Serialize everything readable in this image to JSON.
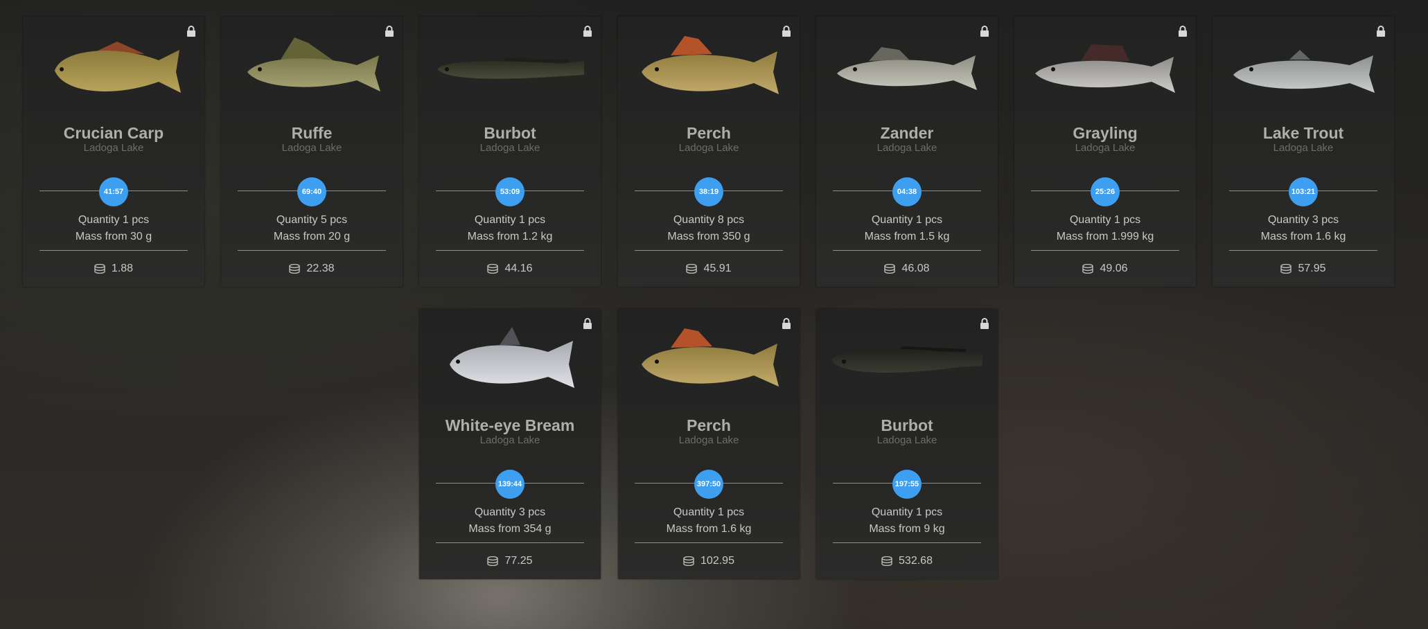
{
  "colors": {
    "timer": "#3e9ff0",
    "card": "#242424"
  },
  "cards": [
    {
      "name": "Crucian Carp",
      "location": "Ladoga Lake",
      "timer": "41:57",
      "quantity": "Quantity 1 pcs",
      "mass": "Mass from 30 g",
      "price": "1.88",
      "fish": "crucian",
      "icon": "lock-icon"
    },
    {
      "name": "Ruffe",
      "location": "Ladoga Lake",
      "timer": "69:40",
      "quantity": "Quantity 5 pcs",
      "mass": "Mass from 20 g",
      "price": "22.38",
      "fish": "ruffe",
      "icon": "lock-icon"
    },
    {
      "name": "Burbot",
      "location": "Ladoga Lake",
      "timer": "53:09",
      "quantity": "Quantity 1 pcs",
      "mass": "Mass from 1.2 kg",
      "price": "44.16",
      "fish": "burbot",
      "icon": "lock-icon"
    },
    {
      "name": "Perch",
      "location": "Ladoga Lake",
      "timer": "38:19",
      "quantity": "Quantity 8 pcs",
      "mass": "Mass from 350 g",
      "price": "45.91",
      "fish": "perch",
      "icon": "lock-icon"
    },
    {
      "name": "Zander",
      "location": "Ladoga Lake",
      "timer": "04:38",
      "quantity": "Quantity 1 pcs",
      "mass": "Mass from 1.5 kg",
      "price": "46.08",
      "fish": "zander",
      "icon": "lock-icon"
    },
    {
      "name": "Grayling",
      "location": "Ladoga Lake",
      "timer": "25:26",
      "quantity": "Quantity 1 pcs",
      "mass": "Mass from 1.999 kg",
      "price": "49.06",
      "fish": "grayling",
      "icon": "lock-icon"
    },
    {
      "name": "Lake Trout",
      "location": "Ladoga Lake",
      "timer": "103:21",
      "quantity": "Quantity 3 pcs",
      "mass": "Mass from 1.6 kg",
      "price": "57.95",
      "fish": "trout",
      "icon": "lock-icon"
    },
    {
      "name": "White-eye Bream",
      "location": "Ladoga Lake",
      "timer": "139:44",
      "quantity": "Quantity 3 pcs",
      "mass": "Mass from 354 g",
      "price": "77.25",
      "fish": "bream",
      "icon": "lock-icon"
    },
    {
      "name": "Perch",
      "location": "Ladoga Lake",
      "timer": "397:50",
      "quantity": "Quantity 1 pcs",
      "mass": "Mass from 1.6 kg",
      "price": "102.95",
      "fish": "perch",
      "icon": "lock-icon"
    },
    {
      "name": "Burbot",
      "location": "Ladoga Lake",
      "timer": "197:55",
      "quantity": "Quantity 1 pcs",
      "mass": "Mass from 9 kg",
      "price": "532.68",
      "fish": "burbot-big",
      "icon": "lock-icon"
    }
  ]
}
